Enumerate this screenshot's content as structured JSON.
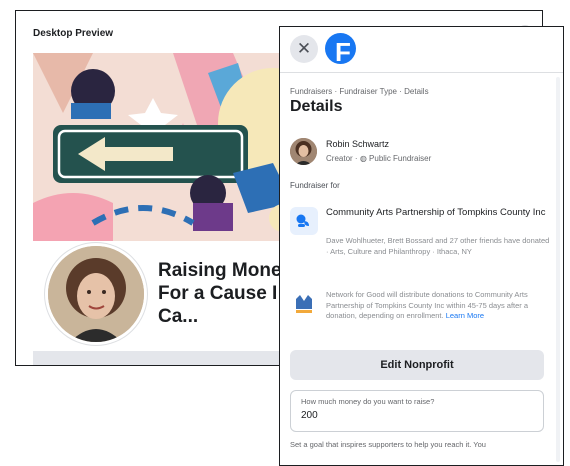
{
  "preview": {
    "title": "Desktop Preview",
    "fundraiser_title": "Raising Money For a Cause I Ca..."
  },
  "panel": {
    "close_icon": "close-icon",
    "logo": "F",
    "breadcrumb": "Fundraisers · Fundraiser Type · Details",
    "title": "Details",
    "creator": {
      "name": "Robin Schwartz",
      "role": "Creator",
      "visibility": "Public Fundraiser"
    },
    "fundraiser_for_label": "Fundraiser for",
    "organization": {
      "name": "Community Arts Partnership of Tompkins County Inc",
      "description": "Dave Wohlhueter, Brett Bossard and 27 other friends have donated · Arts, Culture and Philanthropy · Ithaca, NY"
    },
    "network_notice": "Network for Good will distribute donations to Community Arts Partnership of Tompkins County Inc within 45-75 days after a donation, depending on enrollment.",
    "learn_more": "Learn More",
    "edit_nonprofit": "Edit Nonprofit",
    "goal": {
      "label": "How much money do you want to raise?",
      "value": "200"
    },
    "helper_text": "Set a goal that inspires supporters to help you reach it. You"
  },
  "colors": {
    "accent": "#1877f2",
    "button_bg": "#e4e6eb"
  }
}
